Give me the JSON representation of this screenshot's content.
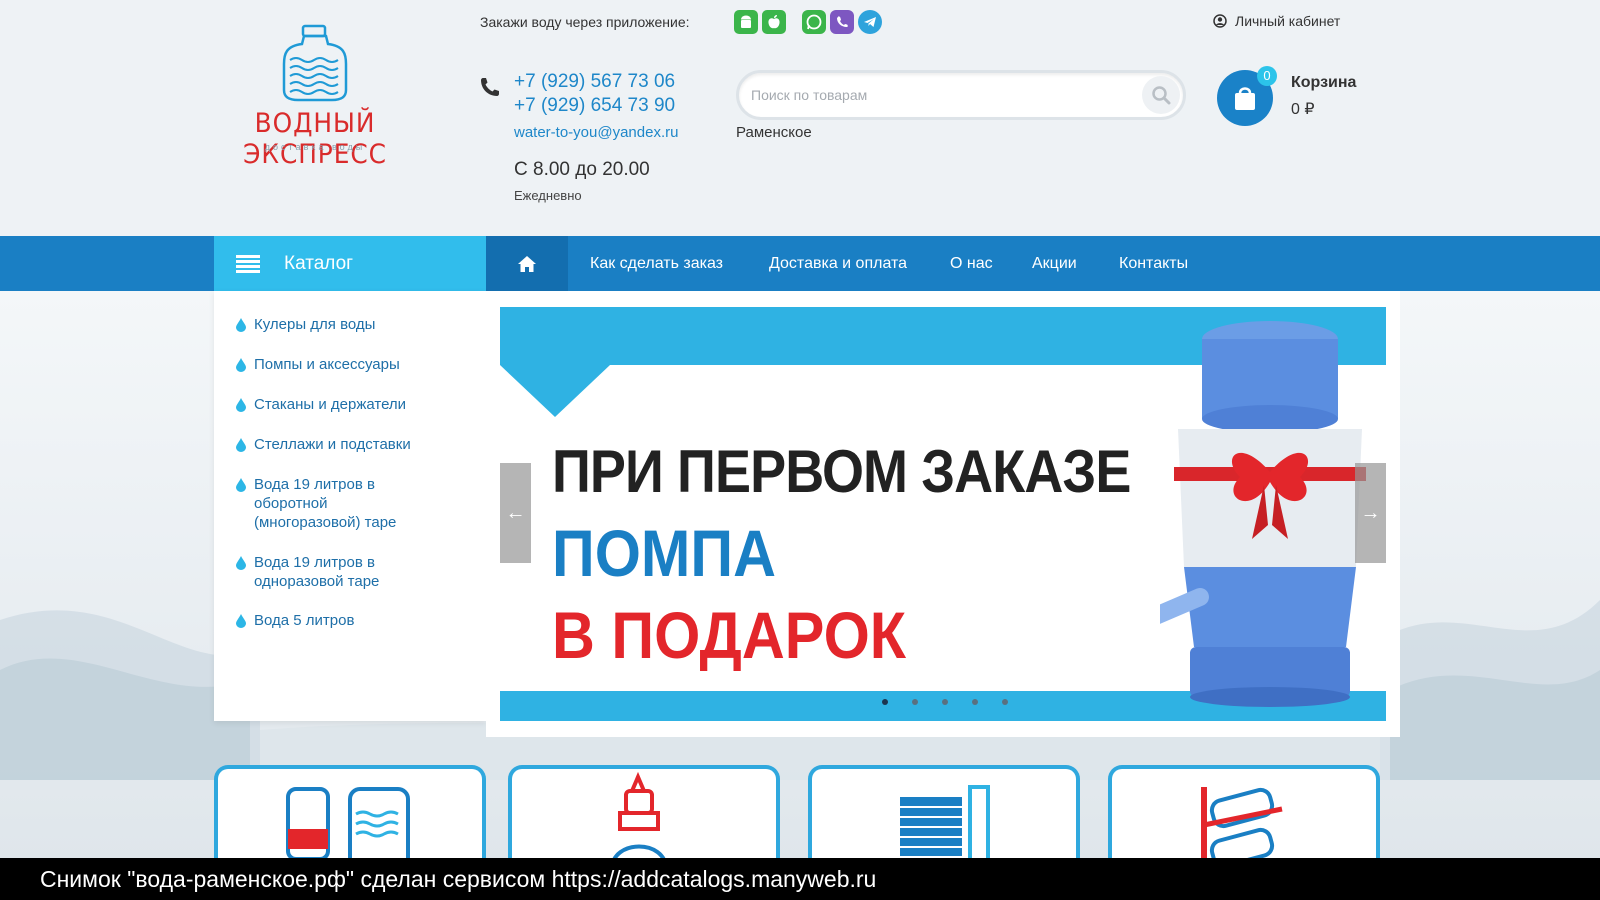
{
  "logo": {
    "title": "ВОДНЫЙ ЭКСПРЕСС",
    "subtitle": "доставка воды"
  },
  "header": {
    "app_label": "Закажи воду через приложение:",
    "app_icons": [
      "android-icon",
      "apple-icon",
      "whatsapp-icon",
      "viber-icon",
      "telegram-icon"
    ],
    "phones": [
      "+7 (929) 567 73 06",
      "+7 (929) 654 73 90"
    ],
    "email": "water-to-you@yandex.ru",
    "hours": "С 8.00 до 20.00",
    "hours_note": "Ежедневно",
    "search_placeholder": "Поиск по товарам",
    "city": "Раменское",
    "account_label": "Личный кабинет",
    "cart_label": "Корзина",
    "cart_count": "0",
    "cart_sum": "0 ₽"
  },
  "nav": {
    "catalog_label": "Каталог",
    "items": [
      {
        "label": "Как сделать заказ"
      },
      {
        "label": "Доставка и оплата"
      },
      {
        "label": "О нас"
      },
      {
        "label": "Акции"
      },
      {
        "label": "Контакты"
      }
    ]
  },
  "sidebar": {
    "items": [
      {
        "label": "Кулеры для воды"
      },
      {
        "label": "Помпы и аксессуары"
      },
      {
        "label": "Стаканы и держатели"
      },
      {
        "label": "Стеллажи и подставки"
      },
      {
        "label": "Вода 19 литров в оборотной (многоразовой) таре"
      },
      {
        "label": "Вода 19 литров в одноразовой таре"
      },
      {
        "label": "Вода 5 литров"
      }
    ]
  },
  "banner": {
    "line1": "ПРИ ПЕРВОМ ЗАКАЗЕ",
    "line2": "ПОМПА",
    "line3": "В ПОДАРОК",
    "prev_arrow": "←",
    "next_arrow": "→",
    "slide_count": 5,
    "active_slide": 1
  },
  "footer_caption": "Снимок \"вода-раменское.рф\" сделан сервисом https://addcatalogs.manyweb.ru",
  "colors": {
    "brand_blue": "#1a7fc4",
    "accent_cyan": "#31bdec",
    "brand_red": "#e3262b",
    "header_bg": "#eef2f5"
  }
}
